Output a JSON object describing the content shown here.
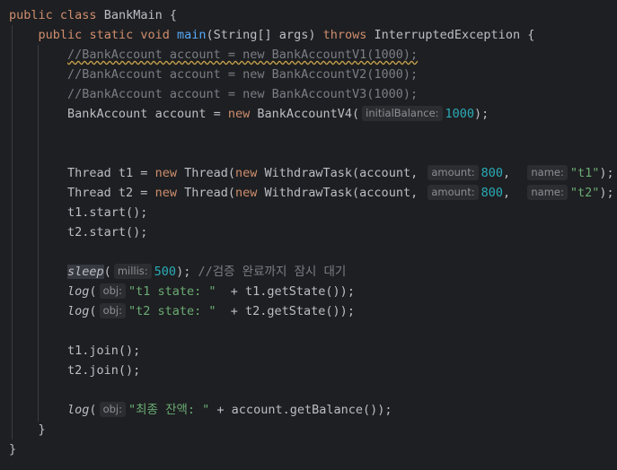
{
  "code": {
    "class_line": {
      "kw_public": "public",
      "kw_class": "class",
      "class_name": "BankMain",
      "brace": "{"
    },
    "main_line": {
      "kw_public": "public",
      "kw_static": "static",
      "kw_void": "void",
      "name": "main",
      "params": "(String[] args)",
      "kw_throws": "throws",
      "exception": "InterruptedException",
      "brace": "{"
    },
    "comment_lines": [
      "//BankAccount account = new BankAccountV1(1000);",
      "//BankAccount account = new BankAccountV2(1000);",
      "//BankAccount account = new BankAccountV3(1000);"
    ],
    "account_line": {
      "pre": "BankAccount account = ",
      "kw_new": "new",
      "cls": " BankAccountV4(",
      "hint": "initialBalance:",
      "value": "1000",
      "post": ");"
    },
    "thread_lines": [
      {
        "pre": "Thread t1 = ",
        "kw_new1": "new",
        "mid1": " Thread(",
        "kw_new2": "new",
        "mid2": " WithdrawTask(account,",
        "hint_amount": "amount:",
        "amount": "800",
        "comma": ",",
        "hint_name": "name:",
        "name": "\"t1\"",
        "post": ");"
      },
      {
        "pre": "Thread t2 = ",
        "kw_new1": "new",
        "mid1": " Thread(",
        "kw_new2": "new",
        "mid2": " WithdrawTask(account,",
        "hint_amount": "amount:",
        "amount": "800",
        "comma": ",",
        "hint_name": "name:",
        "name": "\"t2\"",
        "post": ");"
      }
    ],
    "start_lines": [
      "t1.start();",
      "t2.start();"
    ],
    "sleep_line": {
      "fn": "sleep",
      "open": "(",
      "hint": "millis:",
      "value": "500",
      "close": ");",
      "comment": " //검증 완료까지 잠시 대기"
    },
    "log_state_lines": [
      {
        "fn": "log",
        "open": "(",
        "hint": "obj:",
        "str": "\"t1 state: \"",
        "rest": "  + t1.getState());"
      },
      {
        "fn": "log",
        "open": "(",
        "hint": "obj:",
        "str": "\"t2 state: \"",
        "rest": "  + t2.getState());"
      }
    ],
    "join_lines": [
      "t1.join();",
      "t2.join();"
    ],
    "log_balance_line": {
      "fn": "log",
      "open": "(",
      "hint": "obj:",
      "str": "\"최종 잔액: \"",
      "rest": " + account.getBalance());"
    },
    "close_method": "}",
    "close_class": "}"
  },
  "colors": {
    "background": "#1e1f22",
    "keyword": "#cf8e6d",
    "method": "#56a8f5",
    "number": "#2aacb8",
    "string": "#6aab73",
    "comment": "#7a7e85",
    "default": "#bcbec4"
  }
}
